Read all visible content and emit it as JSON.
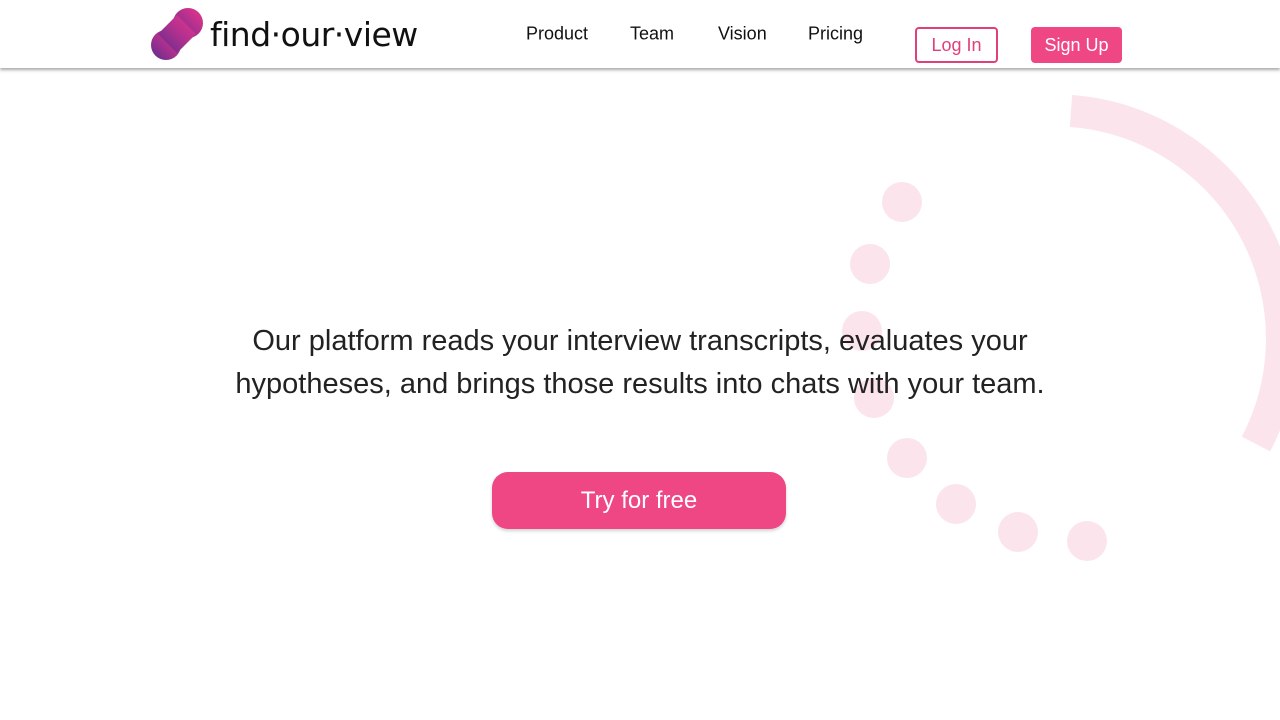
{
  "brand": {
    "name": "find·our·view",
    "gradient_start": "#5b2d8e",
    "gradient_end": "#e8378a"
  },
  "nav": {
    "items": [
      {
        "label": "Product"
      },
      {
        "label": "Team"
      },
      {
        "label": "Vision"
      },
      {
        "label": "Pricing"
      }
    ],
    "login_label": "Log In",
    "signup_label": "Sign Up"
  },
  "hero": {
    "description": "Our platform reads your interview transcripts, evaluates your hypotheses, and brings those results into chats with your team.",
    "cta_label": "Try for free"
  },
  "colors": {
    "accent": "#ee4784",
    "decoration": "#fce4ec",
    "text": "#222222"
  }
}
